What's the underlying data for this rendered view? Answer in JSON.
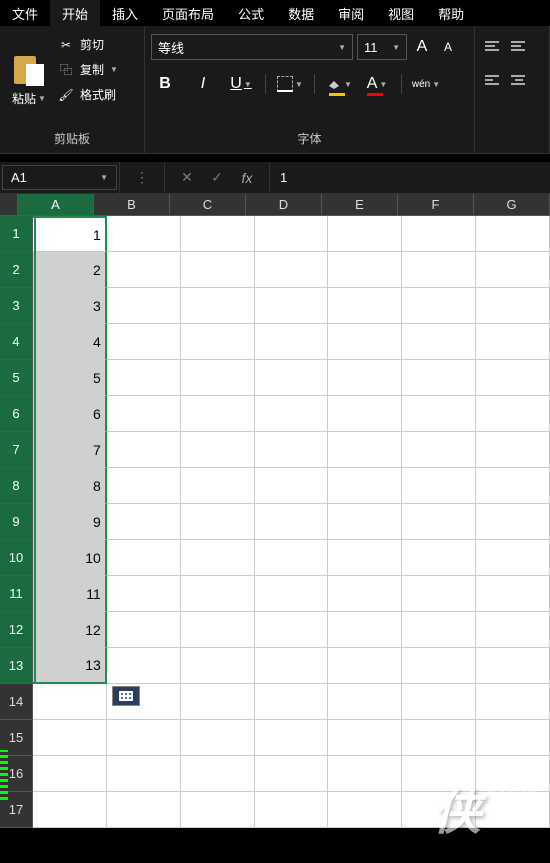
{
  "menu": {
    "items": [
      "文件",
      "开始",
      "插入",
      "页面布局",
      "公式",
      "数据",
      "审阅",
      "视图",
      "帮助"
    ],
    "active_index": 1
  },
  "ribbon": {
    "clipboard": {
      "group_label": "剪贴板",
      "paste": "粘贴",
      "cut": "剪切",
      "copy": "复制",
      "format_painter": "格式刷"
    },
    "font": {
      "group_label": "字体",
      "font_name": "等线",
      "font_size": "11",
      "increase_size": "A",
      "decrease_size": "A",
      "bold": "B",
      "italic": "I",
      "underline": "U",
      "font_color_letter": "A",
      "pinyin": "wén"
    }
  },
  "formula_bar": {
    "name_box": "A1",
    "fx": "fx",
    "value": "1"
  },
  "sheet": {
    "columns": [
      "A",
      "B",
      "C",
      "D",
      "E",
      "F",
      "G"
    ],
    "selected_col": "A",
    "rows": [
      {
        "n": 1,
        "a": "1",
        "selected": true,
        "first": true
      },
      {
        "n": 2,
        "a": "2",
        "selected": true
      },
      {
        "n": 3,
        "a": "3",
        "selected": true
      },
      {
        "n": 4,
        "a": "4",
        "selected": true
      },
      {
        "n": 5,
        "a": "5",
        "selected": true
      },
      {
        "n": 6,
        "a": "6",
        "selected": true
      },
      {
        "n": 7,
        "a": "7",
        "selected": true
      },
      {
        "n": 8,
        "a": "8",
        "selected": true
      },
      {
        "n": 9,
        "a": "9",
        "selected": true
      },
      {
        "n": 10,
        "a": "10",
        "selected": true
      },
      {
        "n": 11,
        "a": "11",
        "selected": true
      },
      {
        "n": 12,
        "a": "12",
        "selected": true
      },
      {
        "n": 13,
        "a": "13",
        "selected": true,
        "last": true
      },
      {
        "n": 14,
        "a": ""
      },
      {
        "n": 15,
        "a": ""
      },
      {
        "n": 16,
        "a": ""
      },
      {
        "n": 17,
        "a": ""
      }
    ]
  },
  "watermark": {
    "char": "侠",
    "url": "xiayx.com",
    "name": "游戏"
  }
}
